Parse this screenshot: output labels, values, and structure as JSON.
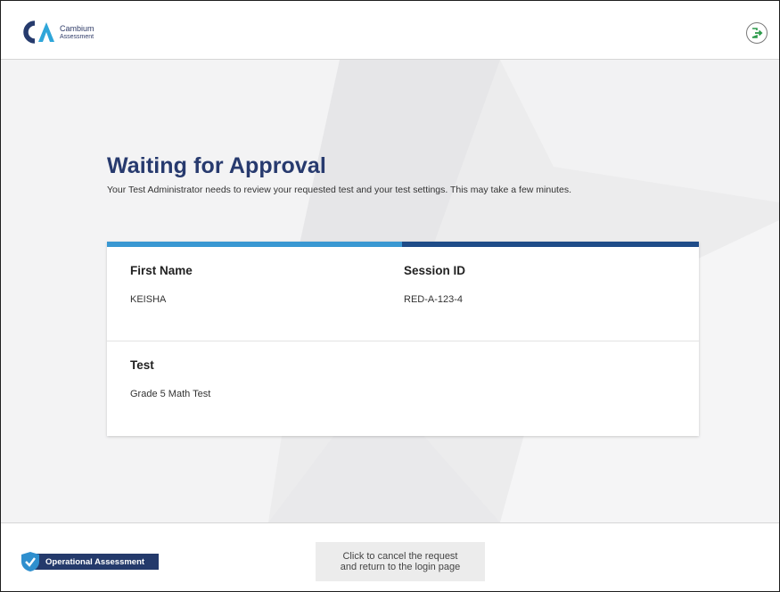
{
  "header": {
    "logo_line1": "Cambium",
    "logo_line2": "Assessment",
    "signout_icon": "sign-out-icon"
  },
  "main": {
    "title": "Waiting for Approval",
    "subtitle": "Your Test Administrator needs to review your requested test and your test settings. This may take a few minutes.",
    "card": {
      "first_name_label": "First Name",
      "first_name_value": "KEISHA",
      "session_id_label": "Session ID",
      "session_id_value": "RED-A-123-4",
      "test_label": "Test",
      "test_value": "Grade 5 Math Test"
    }
  },
  "footer": {
    "badge_label": "Operational Assessment",
    "cancel_button_text": "Click to cancel the request\nand return to the login page"
  },
  "colors": {
    "title": "#273a6e",
    "topbar_light": "#3a98d2",
    "topbar_dark": "#1f4c88",
    "badge": "#243a6b",
    "background": "#ececed"
  }
}
